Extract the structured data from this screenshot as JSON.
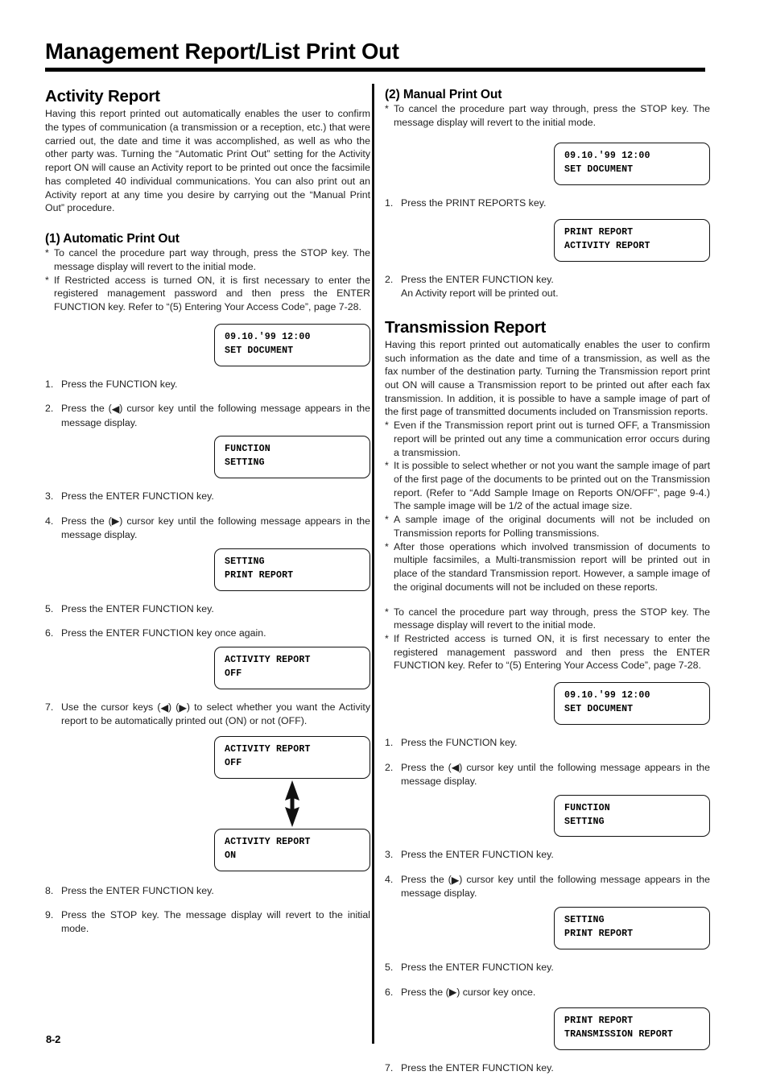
{
  "header": {
    "title": "Management Report/List Print Out"
  },
  "footer": {
    "page_number": "8-2"
  },
  "left_column": {
    "section_title": "Activity Report",
    "intro": "Having this report printed out automatically enables the user to confirm the types of communication (a transmission or a reception, etc.) that were carried out, the date and time it was accomplished, as well as who the other party was. Turning the “Automatic Print Out” setting for the Activity report ON will cause an Activity report to be printed out once the facsimile has completed 40 individual communications. You can also print out an Activity report at any time you desire by carrying out the “Manual Print Out” procedure.",
    "sub_title": "(1) Automatic Print Out",
    "notes": [
      "To cancel the procedure part way through, press the STOP key. The message display will revert to the initial mode.",
      "If Restricted access is turned ON, it is first necessary to enter the registered management password and then press the ENTER FUNCTION key. Refer to “(5) Entering Your Access Code”, page 7-28."
    ],
    "lcd_initial": {
      "line1": "09.10.'99 12:00",
      "line2": "SET DOCUMENT"
    },
    "step1": {
      "num": "1.",
      "text": "Press the FUNCTION key."
    },
    "step2": {
      "num": "2.",
      "text_before": "Press the (",
      "arrow": "left",
      "text_after": ") cursor key until the following message appears in the message display."
    },
    "lcd_function_setting": {
      "line1": "FUNCTION",
      "line2": "SETTING"
    },
    "step3": {
      "num": "3.",
      "text": "Press the ENTER FUNCTION key."
    },
    "step4": {
      "num": "4.",
      "text_before": "Press the (",
      "arrow": "right",
      "text_after": ") cursor key until the following message appears in the message display."
    },
    "lcd_setting_print_report": {
      "line1": "SETTING",
      "line2": "PRINT REPORT"
    },
    "step5": {
      "num": "5.",
      "text": "Press the ENTER FUNCTION key."
    },
    "step6": {
      "num": "6.",
      "text": "Press the ENTER FUNCTION key once again."
    },
    "lcd_activity_off_1": {
      "line1": "ACTIVITY REPORT",
      "line2": "OFF"
    },
    "step7": {
      "num": "7.",
      "text_before": "Use the cursor keys (",
      "arrow1": "left",
      "text_mid": ") (",
      "arrow2": "right",
      "text_after": ") to select whether you want the Activity report to be automatically printed out (ON) or not (OFF)."
    },
    "lcd_activity_off_2": {
      "line1": "ACTIVITY REPORT",
      "line2": "OFF"
    },
    "toggle_arrow": "double-vertical-arrow",
    "lcd_activity_on": {
      "line1": "ACTIVITY REPORT",
      "line2": "ON"
    },
    "step8": {
      "num": "8.",
      "text": "Press the ENTER FUNCTION key."
    },
    "step9": {
      "num": "9.",
      "text": "Press the STOP key. The message display will revert to the initial mode."
    }
  },
  "right_column": {
    "sub_title": "(2) Manual Print Out",
    "notes": [
      "To cancel the procedure part way through, press the STOP key. The message display will revert to the initial mode."
    ],
    "lcd_initial": {
      "line1": "09.10.'99 12:00",
      "line2": "SET DOCUMENT"
    },
    "step1": {
      "num": "1.",
      "text": "Press the PRINT REPORTS key."
    },
    "lcd_print_report_activity": {
      "line1": "PRINT REPORT",
      "line2": "ACTIVITY REPORT"
    },
    "step2": {
      "num": "2.",
      "text": "Press the ENTER FUNCTION key.",
      "text2": "An Activity report will be printed out."
    },
    "section_title": "Transmission Report",
    "intro": "Having this report printed out automatically enables the user to confirm such information as the date and time of a transmission, as well as the fax number of the destination party. Turning the Transmission report print out ON will cause a Transmission report to be printed out after each fax transmission. In addition, it is possible to have a sample image of part of the first page of transmitted documents included on Transmission reports.",
    "notes2": [
      "Even if the Transmission report print out is turned OFF, a Transmission report will be printed out any time a communication error occurs during a transmission.",
      "It is possible to select whether or not you want the sample image of part of the first page of the documents to be printed out on the Transmission report. (Refer to “Add Sample Image on Reports ON/OFF”, page 9-4.) The sample image will be 1/2 of the actual image size.",
      "A sample image of the original documents will not be included on Transmission reports for Polling transmissions.",
      "After those operations which involved transmission of documents to multiple facsimiles, a Multi-transmission report will be printed out in place of the standard Transmission report. However, a sample image of the original documents will not be included on these reports."
    ],
    "notes3": [
      "To cancel the procedure part way through, press the STOP key. The message display will revert to the initial mode.",
      "If Restricted access is turned ON, it is first necessary to enter the registered management password and then press the ENTER FUNCTION key. Refer to “(5) Entering Your Access Code”, page 7-28."
    ],
    "lcd_initial_2": {
      "line1": "09.10.'99 12:00",
      "line2": "SET DOCUMENT"
    },
    "tstep1": {
      "num": "1.",
      "text": "Press the FUNCTION key."
    },
    "tstep2": {
      "num": "2.",
      "text_before": "Press the (",
      "arrow": "left",
      "text_after": ") cursor key until the following message appears in the message display."
    },
    "lcd_function_setting": {
      "line1": "FUNCTION",
      "line2": "SETTING"
    },
    "tstep3": {
      "num": "3.",
      "text": "Press the ENTER FUNCTION key."
    },
    "tstep4": {
      "num": "4.",
      "text_before": "Press the (",
      "arrow": "right",
      "text_after": ") cursor key until the following message appears in the message display."
    },
    "lcd_setting_print_report": {
      "line1": "SETTING",
      "line2": "PRINT REPORT"
    },
    "tstep5": {
      "num": "5.",
      "text": "Press the ENTER FUNCTION key."
    },
    "tstep6": {
      "num": "6.",
      "text_before": "Press the (",
      "arrow": "right",
      "text_after": ") cursor key once."
    },
    "lcd_print_report_transmission": {
      "line1": "PRINT REPORT",
      "line2": "TRANSMISSION REPORT"
    },
    "tstep7": {
      "num": "7.",
      "text": "Press the ENTER FUNCTION key."
    }
  }
}
